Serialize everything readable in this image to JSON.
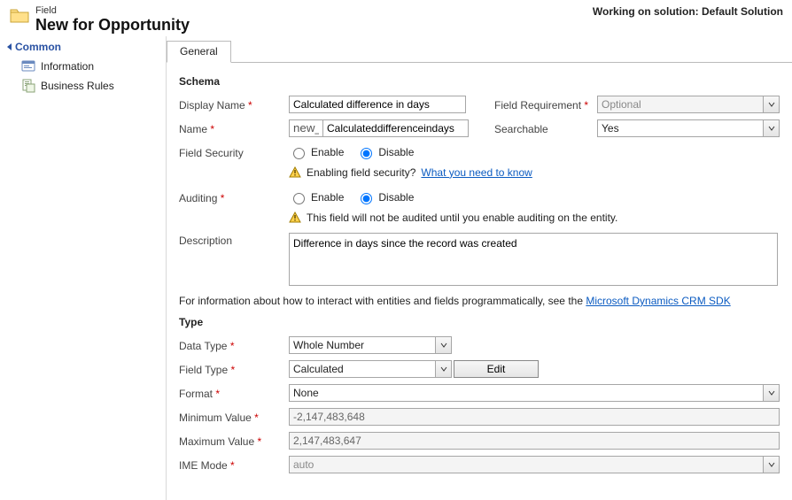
{
  "header": {
    "entity_label": "Field",
    "title": "New for Opportunity",
    "solution_prefix": "Working on solution: ",
    "solution_name": "Default Solution"
  },
  "sidebar": {
    "section_title": "Common",
    "items": [
      {
        "label": "Information",
        "icon": "info"
      },
      {
        "label": "Business Rules",
        "icon": "rules"
      }
    ]
  },
  "tabs": {
    "general": "General"
  },
  "schema": {
    "heading": "Schema",
    "display_name_label": "Display Name",
    "display_name_value": "Calculated difference in days",
    "field_requirement_label": "Field Requirement",
    "field_requirement_value": "Optional",
    "name_label": "Name",
    "name_prefix": "new_",
    "name_value": "Calculateddifferenceindays",
    "searchable_label": "Searchable",
    "searchable_value": "Yes",
    "field_security_label": "Field Security",
    "enable_label": "Enable",
    "disable_label": "Disable",
    "field_security_value": "Disable",
    "fs_info_prefix": "Enabling field security? ",
    "fs_info_link": "What you need to know",
    "auditing_label": "Auditing",
    "auditing_value": "Disable",
    "auditing_info": "This field will not be audited until you enable auditing on the entity.",
    "description_label": "Description",
    "description_value": "Difference in days since the record was created",
    "sdk_prefix": "For information about how to interact with entities and fields programmatically, see the ",
    "sdk_link": "Microsoft Dynamics CRM SDK"
  },
  "type": {
    "heading": "Type",
    "data_type_label": "Data Type",
    "data_type_value": "Whole Number",
    "field_type_label": "Field Type",
    "field_type_value": "Calculated",
    "edit_button": "Edit",
    "format_label": "Format",
    "format_value": "None",
    "min_label": "Minimum Value",
    "min_value": "-2,147,483,648",
    "max_label": "Maximum Value",
    "max_value": "2,147,483,647",
    "ime_label": "IME Mode",
    "ime_value": "auto"
  }
}
